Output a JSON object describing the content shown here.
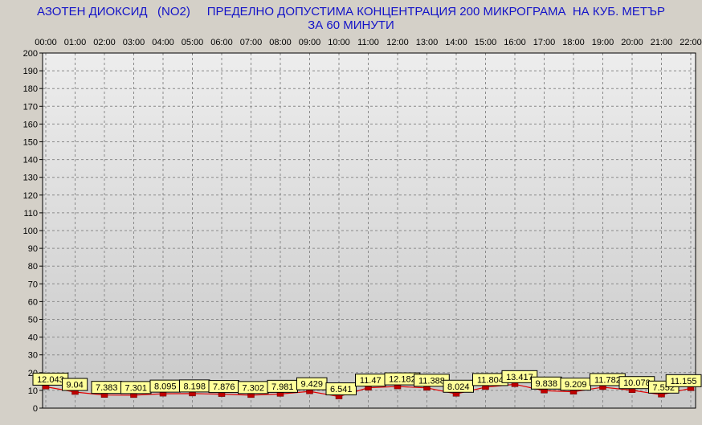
{
  "title": {
    "line1": "АЗОТЕН ДИОКСИД   (NO2)     ПРЕДЕЛНО ДОПУСТИМА КОНЦЕНТРАЦИЯ 200 МИКРОГРАМА  НА КУБ. МЕТЪР",
    "line2": "ЗА 60 МИНУТИ"
  },
  "colors": {
    "background": "#d4d0c8",
    "plot_top": "#ededed",
    "plot_bottom": "#c9c9c9",
    "title": "#1414c8",
    "grid": "#8a8a8a",
    "line": "#e00000",
    "marker": "#c00000",
    "label_fill": "#ffff99"
  },
  "chart_data": {
    "type": "line",
    "categories": [
      "00:00",
      "01:00",
      "02:00",
      "03:00",
      "04:00",
      "05:00",
      "06:00",
      "07:00",
      "08:00",
      "09:00",
      "10:00",
      "11:00",
      "12:00",
      "13:00",
      "14:00",
      "15:00",
      "16:00",
      "17:00",
      "18:00",
      "19:00",
      "20:00",
      "21:00",
      "22:00"
    ],
    "values": [
      12.043,
      9.04,
      7.383,
      7.301,
      8.095,
      8.198,
      7.876,
      7.302,
      7.981,
      9.429,
      6.541,
      11.47,
      12.182,
      11.388,
      8.024,
      11.804,
      13.417,
      9.838,
      9.209,
      11.782,
      10.078,
      7.552,
      11.155
    ],
    "value_labels": [
      "12.043",
      "9.04",
      "7.383",
      "7.301",
      "8.095",
      "8.198",
      "7.876",
      "7.302",
      "7.981",
      "9.429",
      "6.541",
      "11.47",
      "12.182",
      "11.388",
      "8.024",
      "11.804",
      "13.417",
      "9.838",
      "9.209",
      "11.782",
      "10.078",
      "7.552",
      "11.155"
    ],
    "ylim": [
      0,
      200
    ],
    "yticks": [
      "0",
      "10",
      "20",
      "30",
      "40",
      "50",
      "60",
      "70",
      "80",
      "90",
      "100",
      "110",
      "120",
      "130",
      "140",
      "150",
      "160",
      "170",
      "180",
      "190",
      "200"
    ],
    "grid": true,
    "x_axis_position": "top"
  }
}
